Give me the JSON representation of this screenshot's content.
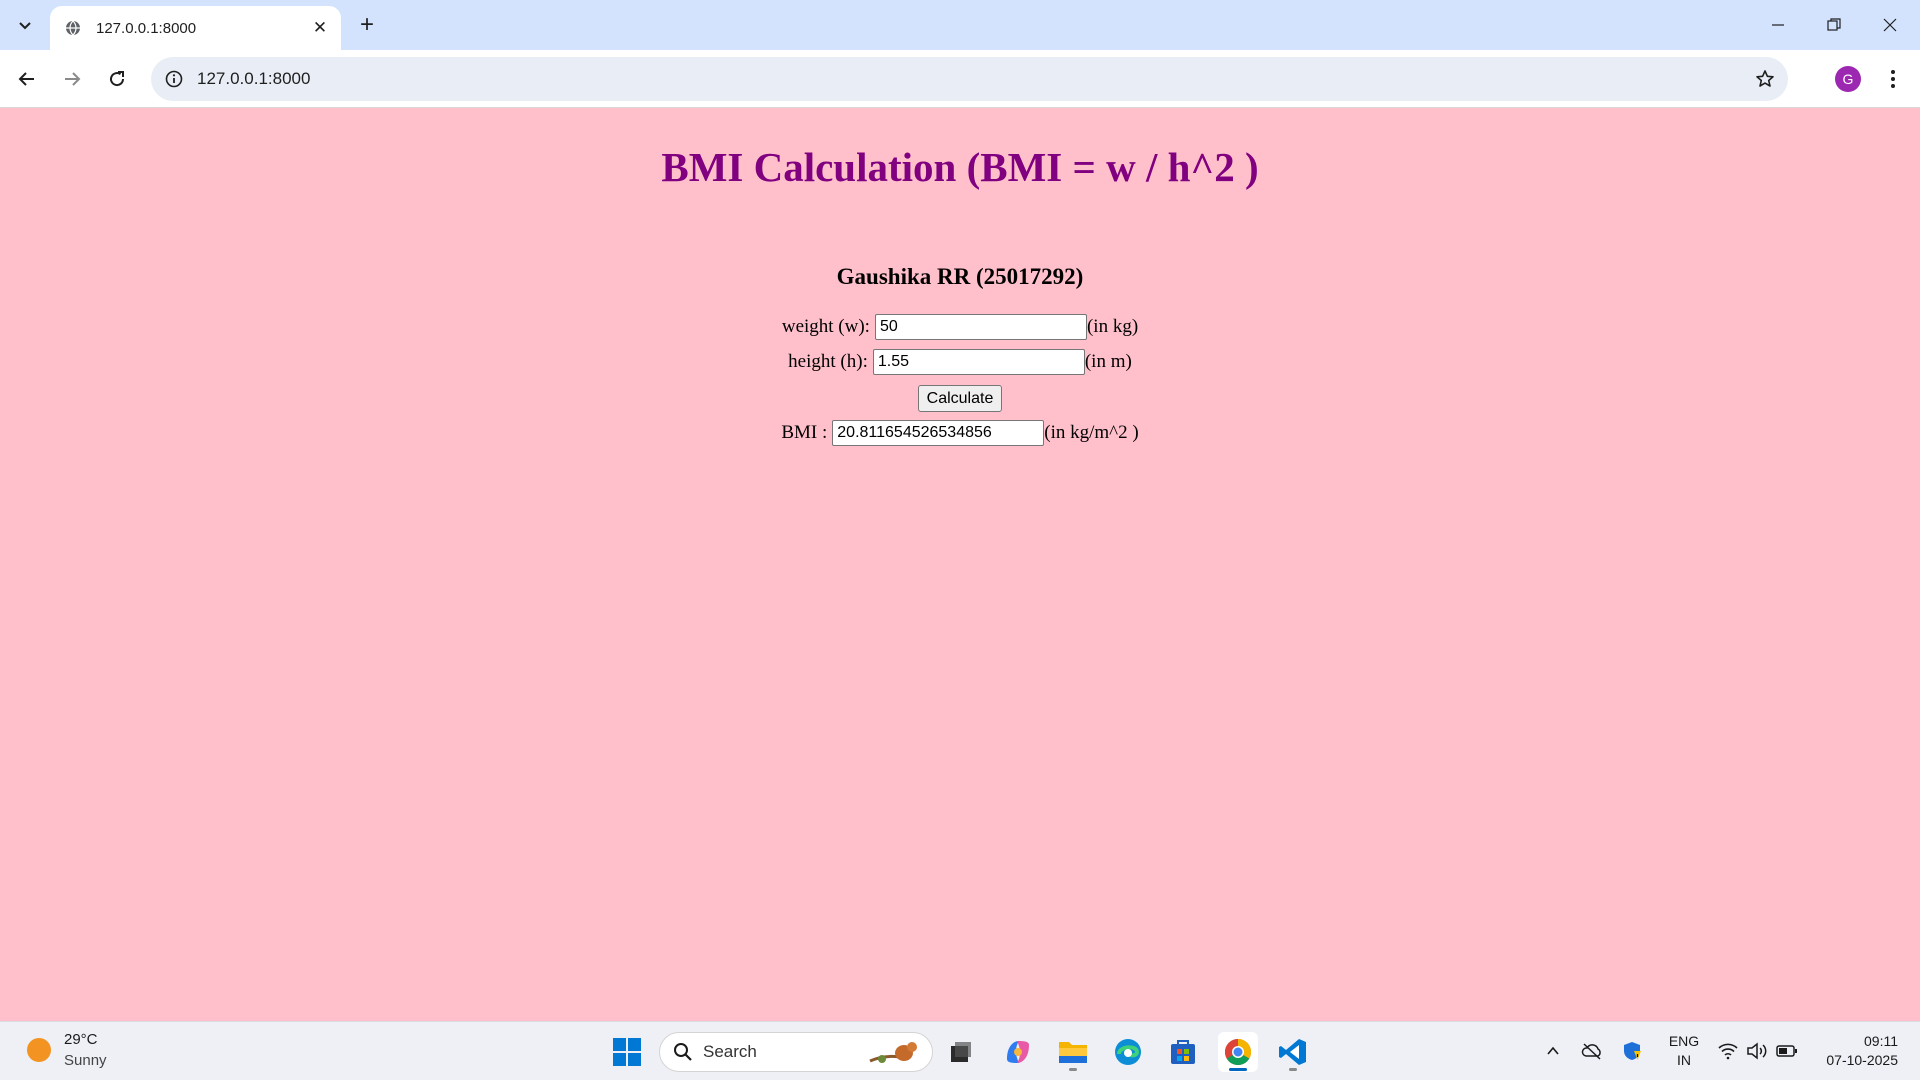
{
  "browser": {
    "tab_title": "127.0.0.1:8000",
    "url": "127.0.0.1:8000",
    "profile_initial": "G"
  },
  "page": {
    "heading": "BMI Calculation (BMI = w / h^2 )",
    "student": "Gaushika RR (25017292)",
    "weight": {
      "label": "weight (w):",
      "value": "50",
      "unit": "(in kg)"
    },
    "height": {
      "label": "height (h):",
      "value": "1.55",
      "unit": "(in m)"
    },
    "calculate_label": "Calculate",
    "bmi": {
      "label": "BMI :",
      "value": "20.811654526534856",
      "unit": "(in kg/m^2 )"
    }
  },
  "taskbar": {
    "weather_temp": "29°C",
    "weather_desc": "Sunny",
    "search_label": "Search",
    "lang_line1": "ENG",
    "lang_line2": "IN",
    "time": "09:11",
    "date": "07-10-2025"
  },
  "colors": {
    "page_background": "#ffc0cb",
    "heading": "#800080",
    "chrome_titlebar": "#d3e3fd"
  }
}
